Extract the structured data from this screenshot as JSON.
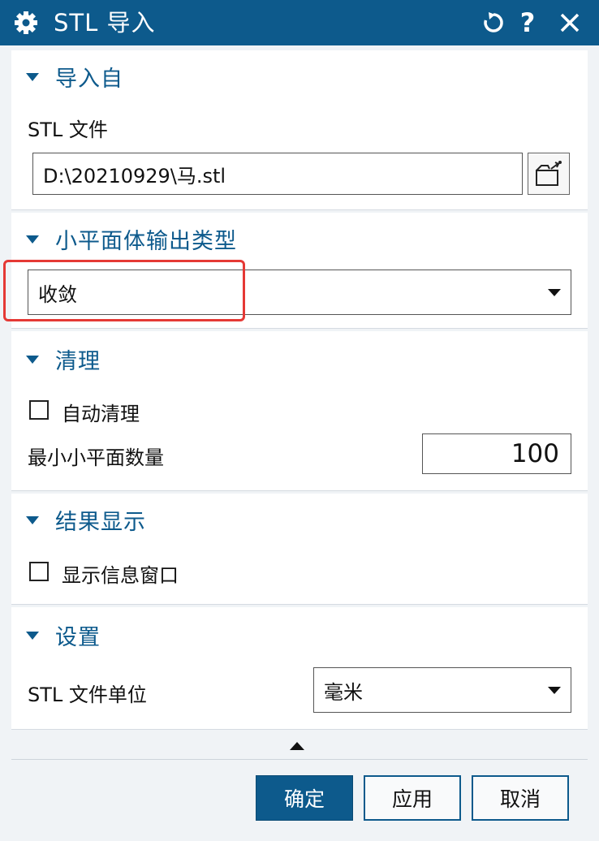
{
  "dialog": {
    "title": "STL 导入",
    "icons": {
      "settings": "gear-icon",
      "reset": "reset-icon",
      "help": "?",
      "close": "close-icon"
    }
  },
  "sections": {
    "import_from": {
      "header": "导入自",
      "file_label": "STL 文件",
      "file_value": "D:\\20210929\\马.stl"
    },
    "facet_output": {
      "header": "小平面体输出类型",
      "type_value": "收敛"
    },
    "cleanup": {
      "header": "清理",
      "auto_cleanup_label": "自动清理",
      "auto_cleanup_checked": false,
      "min_facets_label": "最小小平面数量",
      "min_facets_value": "100"
    },
    "result_display": {
      "header": "结果显示",
      "show_info_label": "显示信息窗口",
      "show_info_checked": false
    },
    "settings": {
      "header": "设置",
      "units_label": "STL 文件单位",
      "units_value": "毫米"
    }
  },
  "buttons": {
    "ok": "确定",
    "apply": "应用",
    "cancel": "取消"
  },
  "colors": {
    "accent": "#0d5a8c",
    "highlight": "#e53935"
  }
}
